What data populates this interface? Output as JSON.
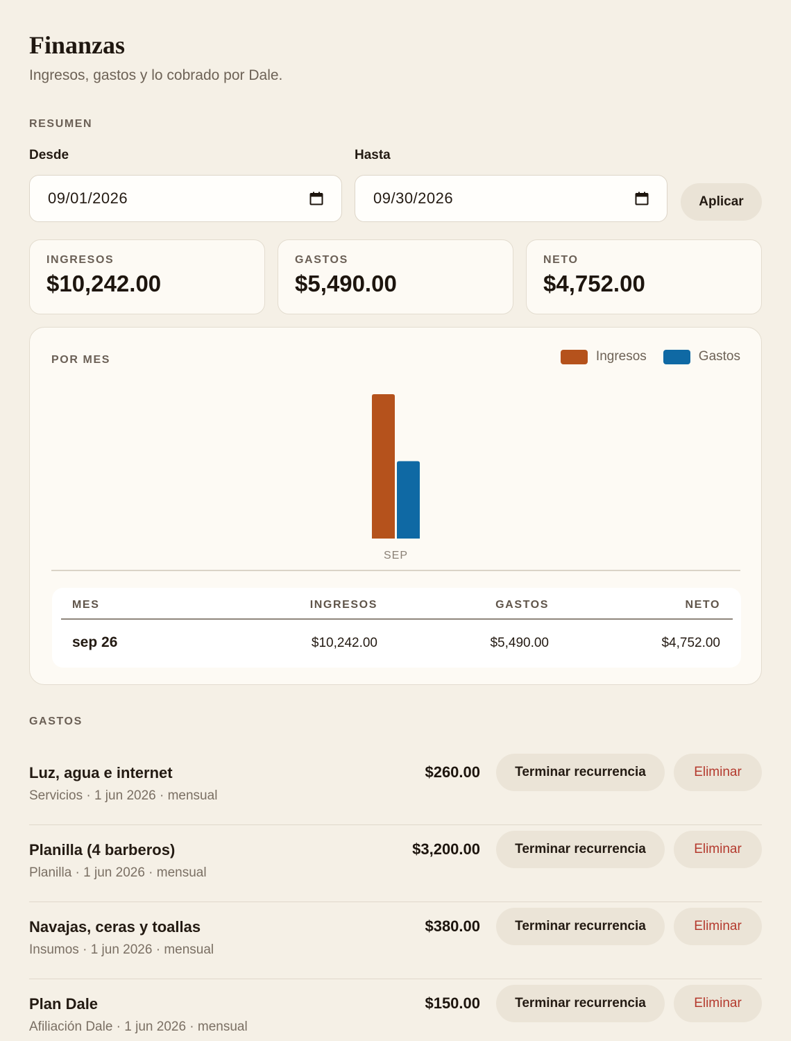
{
  "header": {
    "title": "Finanzas",
    "subtitle": "Ingresos, gastos y lo cobrado por Dale."
  },
  "summary": {
    "section_label": "RESUMEN",
    "from_label": "Desde",
    "from_value": "09/01/2026",
    "to_label": "Hasta",
    "to_value": "09/30/2026",
    "apply_label": "Aplicar",
    "cards": [
      {
        "label": "INGRESOS",
        "value": "$10,242.00"
      },
      {
        "label": "GASTOS",
        "value": "$5,490.00"
      },
      {
        "label": "NETO",
        "value": "$4,752.00"
      }
    ]
  },
  "monthly": {
    "title": "POR MES",
    "legend": [
      {
        "label": "Ingresos",
        "color": "#b5521c"
      },
      {
        "label": "Gastos",
        "color": "#0f69a4"
      }
    ],
    "table": {
      "headers": [
        "MES",
        "INGRESOS",
        "GASTOS",
        "NETO"
      ],
      "rows": [
        {
          "month": "sep 26",
          "ingresos": "$10,242.00",
          "gastos": "$5,490.00",
          "neto": "$4,752.00"
        }
      ]
    }
  },
  "chart_data": {
    "type": "bar",
    "categories": [
      "SEP"
    ],
    "series": [
      {
        "name": "Ingresos",
        "color": "#b5521c",
        "values": [
          10242
        ]
      },
      {
        "name": "Gastos",
        "color": "#0f69a4",
        "values": [
          5490
        ]
      }
    ],
    "title": "POR MES",
    "ylim": [
      0,
      10242
    ],
    "grid": false,
    "legend_position": "top-right"
  },
  "expenses": {
    "section_label": "GASTOS",
    "end_recurrence_label": "Terminar recurrencia",
    "delete_label": "Eliminar",
    "items": [
      {
        "name": "Luz, agua e internet",
        "meta": "Servicios · 1 jun 2026 · mensual",
        "amount": "$260.00"
      },
      {
        "name": "Planilla (4 barberos)",
        "meta": "Planilla · 1 jun 2026 · mensual",
        "amount": "$3,200.00"
      },
      {
        "name": "Navajas, ceras y toallas",
        "meta": "Insumos · 1 jun 2026 · mensual",
        "amount": "$380.00"
      },
      {
        "name": "Plan Dale",
        "meta": "Afiliación Dale · 1 jun 2026 · mensual",
        "amount": "$150.00"
      }
    ]
  }
}
